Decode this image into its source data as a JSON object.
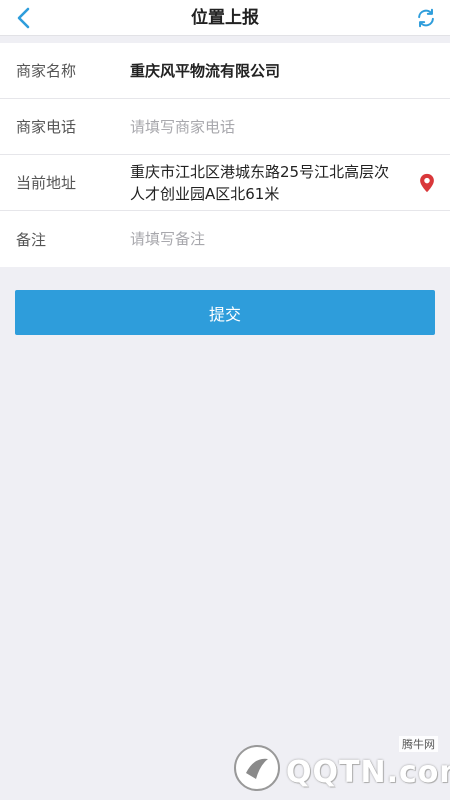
{
  "header": {
    "title": "位置上报",
    "back_icon": "chevron-left-icon",
    "refresh_icon": "refresh-icon"
  },
  "form": {
    "merchant_name": {
      "label": "商家名称",
      "value": "重庆风平物流有限公司"
    },
    "merchant_phone": {
      "label": "商家电话",
      "value": "",
      "placeholder": "请填写商家电话"
    },
    "current_address": {
      "label": "当前地址",
      "value": "重庆市江北区港城东路25号江北高层次人才创业园A区北61米",
      "icon": "location-pin-icon"
    },
    "remark": {
      "label": "备注",
      "value": "",
      "placeholder": "请填写备注"
    }
  },
  "submit_label": "提交",
  "watermark": {
    "text": "QQTN.com",
    "tag": "腾牛网"
  },
  "colors": {
    "accent": "#2e9ddb",
    "background": "#efeff4",
    "pin": "#d9373a"
  }
}
